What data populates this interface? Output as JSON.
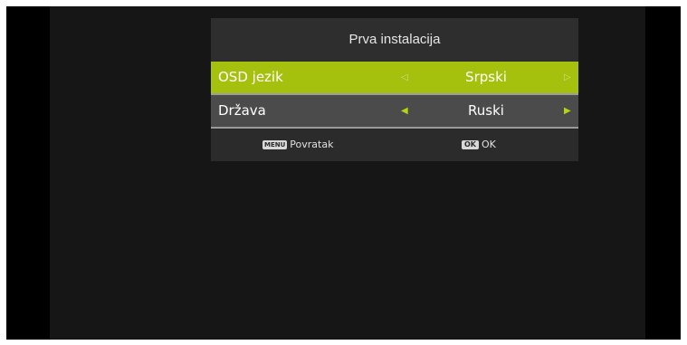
{
  "dialog": {
    "title": "Prva instalacija"
  },
  "rows": [
    {
      "label": "OSD jezik",
      "value": "Srpski",
      "left_arrow": "◁",
      "right_arrow": "▷",
      "selected": true
    },
    {
      "label": "Država",
      "value": "Ruski",
      "left_arrow": "◀",
      "right_arrow": "▶",
      "selected": false
    }
  ],
  "footer": {
    "back_key": "MENU",
    "back_label": "Povratak",
    "ok_key": "OK",
    "ok_label": "OK"
  },
  "colors": {
    "highlight": "#a5c00d",
    "row_bg": "#4b4b4b",
    "dialog_bg": "#2b2b2b",
    "arrow_accent": "#b8d40f"
  },
  "icons": [
    "left-arrow-icon",
    "right-arrow-icon",
    "menu-key-icon",
    "ok-key-icon"
  ]
}
